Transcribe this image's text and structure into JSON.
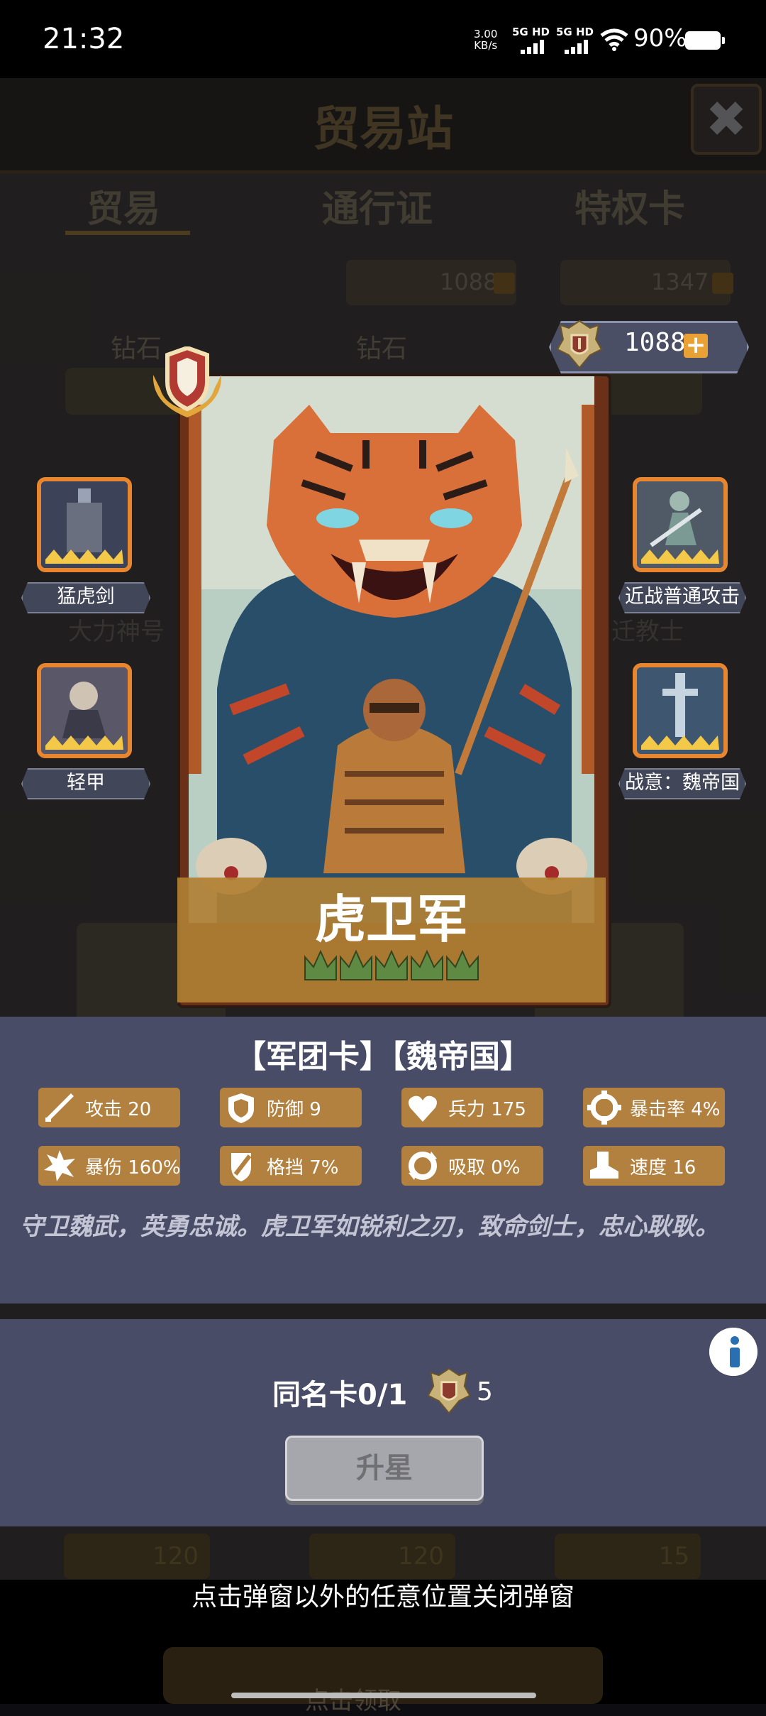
{
  "status_bar": {
    "time": "21:32",
    "net_speed_value": "3.00",
    "net_speed_unit": "KB/s",
    "sig1": "5G HD",
    "sig2": "5G HD",
    "battery": "90%"
  },
  "background": {
    "title": "贸易站",
    "tabs": [
      "贸易",
      "通行证",
      "特权卡"
    ],
    "resources": [
      "1088",
      "1347"
    ],
    "labels": [
      "钻石",
      "钻石"
    ],
    "faded_names": [
      "大力神号",
      "迁教士"
    ],
    "prices": [
      "120",
      "120",
      "15"
    ],
    "bottom_partial": "点击领取"
  },
  "modal": {
    "currency": {
      "value": "1088",
      "plus": "+"
    },
    "card": {
      "name": "虎卫军",
      "stars": 5
    },
    "skills": {
      "left_top": "猛虎剑",
      "left_bottom": "轻甲",
      "right_top": "近战普通攻击",
      "right_bottom": "战意：魏帝国"
    },
    "tags": "【军团卡】【魏帝国】",
    "stats": [
      {
        "label": "攻击 20",
        "icon": "sword-icon"
      },
      {
        "label": "防御 9",
        "icon": "shield-icon"
      },
      {
        "label": "兵力 175",
        "icon": "heart-icon"
      },
      {
        "label": "暴击率 4%",
        "icon": "crosshair-icon"
      },
      {
        "label": "暴伤 160%",
        "icon": "burst-icon"
      },
      {
        "label": "格挡 7%",
        "icon": "block-icon"
      },
      {
        "label": "吸取 0%",
        "icon": "drain-icon"
      },
      {
        "label": "速度 16",
        "icon": "boot-icon"
      }
    ],
    "description": "守卫魏武，英勇忠诚。虎卫军如锐利之刃，致命剑士，忠心耿耿。",
    "same_card": "同名卡0/1",
    "upgrade_cost": "5",
    "upgrade_button": "升星"
  },
  "hint": "点击弹窗以外的任意位置关闭弹窗",
  "colors": {
    "panel": "#494c67",
    "stat_bg": "#b2813f",
    "skill_border": "#e7862f",
    "card_band": "#b08034"
  }
}
